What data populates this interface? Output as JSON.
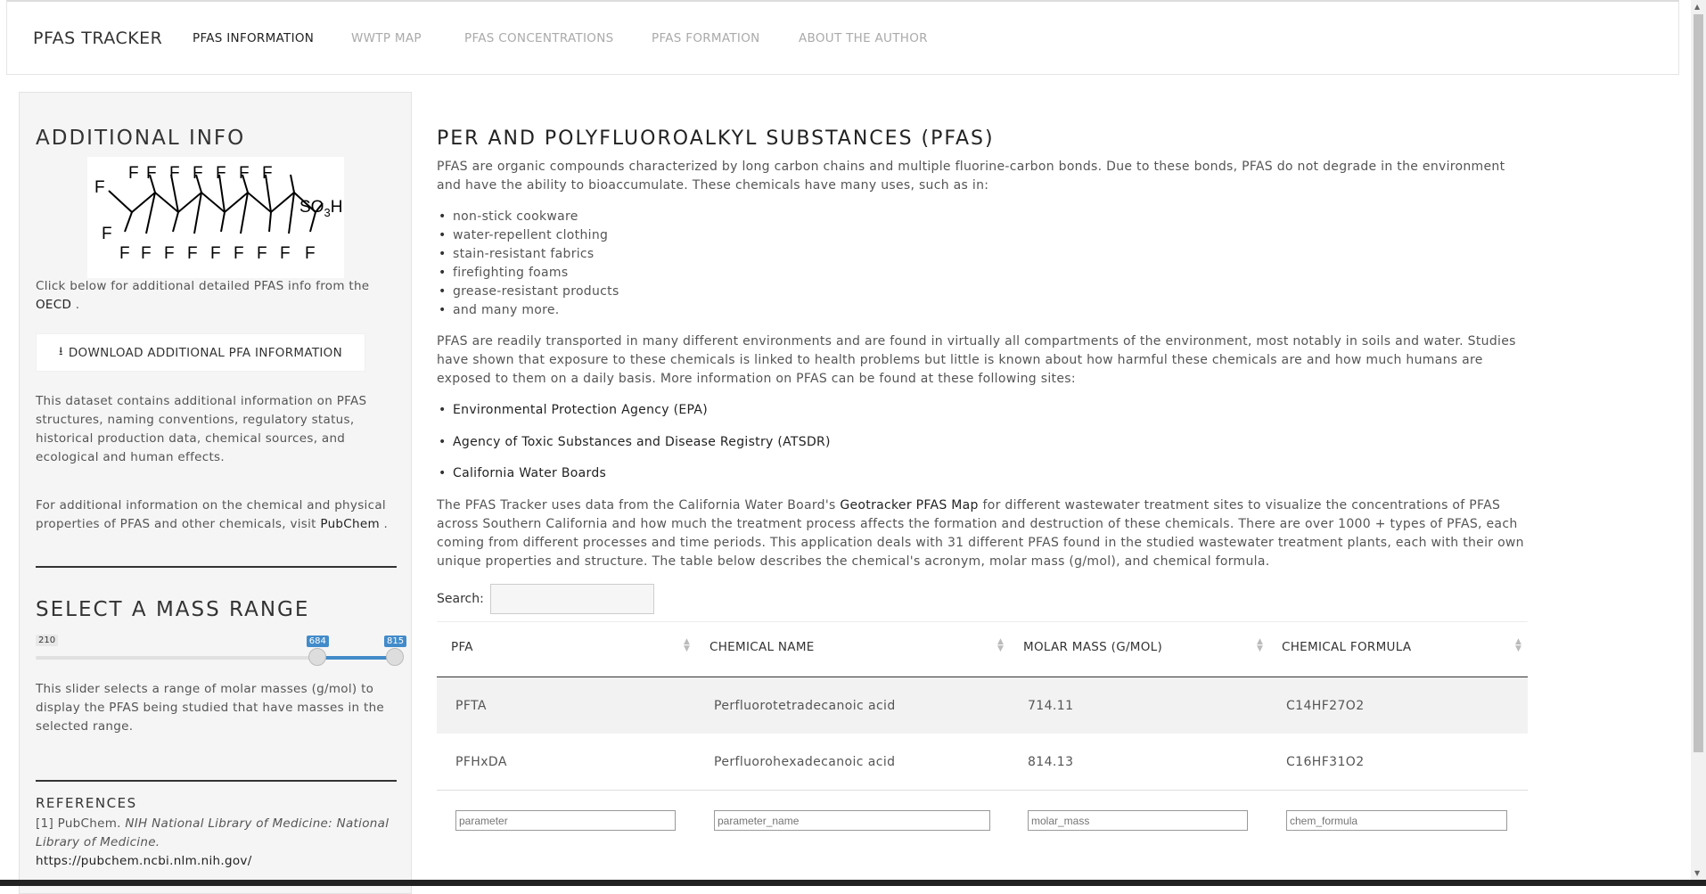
{
  "navbar": {
    "brand": "PFAS TRACKER",
    "items": [
      {
        "label": "PFAS INFORMATION"
      },
      {
        "label": "WWTP MAP"
      },
      {
        "label": "PFAS CONCENTRATIONS"
      },
      {
        "label": "PFAS FORMATION"
      },
      {
        "label": "ABOUT THE AUTHOR"
      }
    ]
  },
  "sidebar": {
    "additional_title": "ADDITIONAL INFO",
    "molecule": {
      "f": "F",
      "so3h": "SO3H"
    },
    "click_text": "Click below for additional detailed PFAS info from the",
    "oecd_link": "OECD",
    "period": ".",
    "download_label": "DOWNLOAD ADDITIONAL PFA INFORMATION",
    "dataset_text": "This dataset contains additional information on PFAS structures, naming conventions, regulatory status, historical production data, chemical sources, and ecological and human effects.",
    "additional_text": "For additional information on the chemical and physical properties of PFAS and other chemicals, visit",
    "pubchem_link": "PubChem",
    "mass_title": "SELECT A MASS RANGE",
    "slider": {
      "min": 210,
      "max": 815,
      "low": 684,
      "high": 815,
      "min_label": "210",
      "low_label": "684",
      "high_label": "815"
    },
    "slider_text": "This slider selects a range of molar masses (g/mol) to display the PFAS being studied that have masses in the selected range.",
    "references_title": "REFERENCES",
    "ref_prefix": "[1] PubChem.",
    "ref_italic": "NIH National Library of Medicine: National Library of Medicine.",
    "ref_url": "https://pubchem.ncbi.nlm.nih.gov/"
  },
  "main": {
    "title": "PER AND POLYFLUOROALKYL SUBSTANCES (PFAS)",
    "intro": "PFAS are organic compounds characterized by long carbon chains and multiple fluorine-carbon bonds. Due to these bonds, PFAS do not degrade in the environment and have the ability to bioaccumulate. These chemicals have many uses, such as in:",
    "uses": [
      "non-stick cookware",
      "water-repellent clothing",
      "stain-resistant fabrics",
      "firefighting foams",
      "grease-resistant products",
      "and many more."
    ],
    "transport": "PFAS are readily transported in many different environments and are found in virtually all compartments of the environment, most notably in soils and water. Studies have shown that exposure to these chemicals is linked to health problems but little is known about how harmful these chemicals are and how much humans are exposed to them on a daily basis. More information on PFAS can be found at these following sites:",
    "sites": [
      "Environmental Protection Agency (EPA)",
      "Agency of Toxic Substances and Disease Registry (ATSDR)",
      "California Water Boards"
    ],
    "tracker_pre": "The PFAS Tracker uses data from the California Water Board's",
    "tracker_link": "Geotracker PFAS Map",
    "tracker_post": "for different wastewater treatment sites to visualize the concentrations of PFAS across Southern California and how much the treatment process affects the formation and destruction of these chemicals. There are over 1000 + types of PFAS, each coming from different processes and time periods. This application deals with 31 different PFAS found in the studied wastewater treatment plants, each with their own unique properties and structure. The table below describes the chemical's acronym, molar mass (g/mol), and chemical formula.",
    "search_label": "Search:",
    "table": {
      "headers": [
        "PFA",
        "CHEMICAL NAME",
        "MOLAR MASS (G/MOL)",
        "CHEMICAL FORMULA"
      ],
      "rows": [
        [
          "PFTA",
          "Perfluorotetradecanoic acid",
          "714.11",
          "C14HF27O2"
        ],
        [
          "PFHxDA",
          "Perfluorohexadecanoic acid",
          "814.13",
          "C16HF31O2"
        ]
      ],
      "filters": [
        "parameter",
        "parameter_name",
        "molar_mass",
        "chem_formula"
      ]
    }
  },
  "colors": {
    "accent": "#428bca",
    "sidebar_bg": "#f5f5f5",
    "row_stripe": "#f2f2f2"
  }
}
